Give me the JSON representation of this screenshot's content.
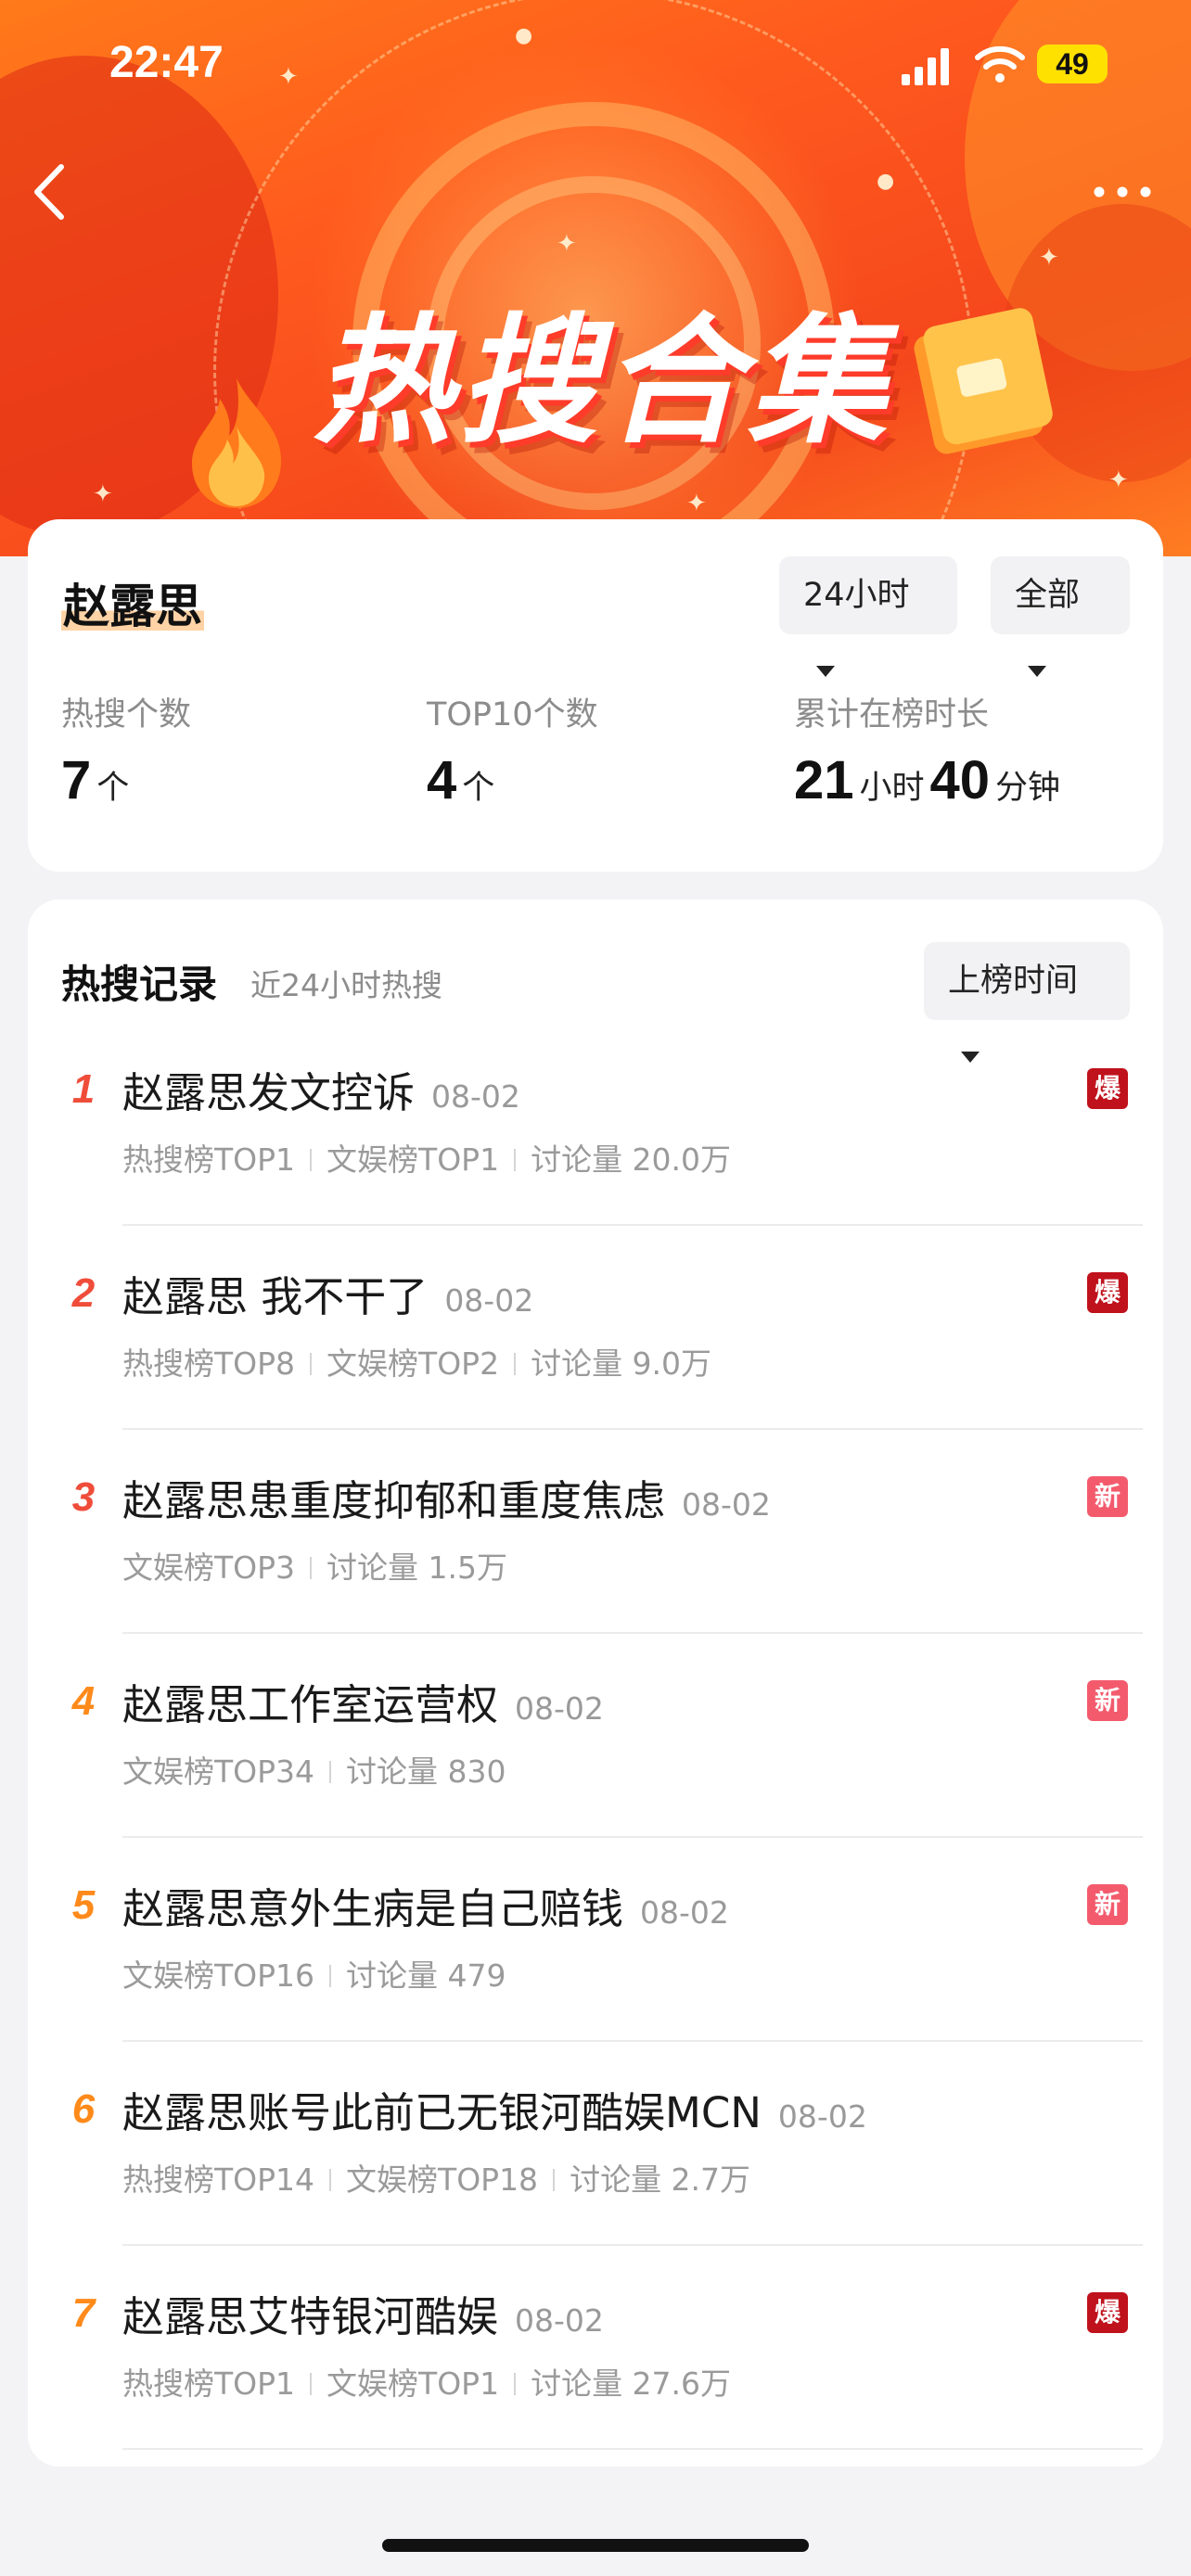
{
  "status_bar": {
    "time": "22:47",
    "battery": "49"
  },
  "banner": {
    "title": "热搜合集"
  },
  "summary": {
    "name": "赵露思",
    "filter_time": "24小时",
    "filter_scope": "全部",
    "stats": [
      {
        "label": "热搜个数",
        "value": "7",
        "unit": "个"
      },
      {
        "label": "TOP10个数",
        "value": "4",
        "unit": "个"
      },
      {
        "label": "累计在榜时长",
        "hours": "21",
        "hours_unit": "小时",
        "minutes": "40",
        "minutes_unit": "分钟"
      }
    ]
  },
  "records": {
    "title": "热搜记录",
    "subtitle": "近24小时热搜",
    "sort_label": "上榜时间",
    "items": [
      {
        "rank": "1",
        "title": "赵露思发文控诉",
        "date": "08-02",
        "meta": [
          "热搜榜TOP1",
          "文娱榜TOP1",
          "讨论量 20.0万"
        ],
        "badge": "爆"
      },
      {
        "rank": "2",
        "title": "赵露思 我不干了",
        "date": "08-02",
        "meta": [
          "热搜榜TOP8",
          "文娱榜TOP2",
          "讨论量 9.0万"
        ],
        "badge": "爆"
      },
      {
        "rank": "3",
        "title": "赵露思患重度抑郁和重度焦虑",
        "date": "08-02",
        "meta": [
          "文娱榜TOP3",
          "讨论量 1.5万"
        ],
        "badge": "新"
      },
      {
        "rank": "4",
        "title": "赵露思工作室运营权",
        "date": "08-02",
        "meta": [
          "文娱榜TOP34",
          "讨论量 830"
        ],
        "badge": "新"
      },
      {
        "rank": "5",
        "title": "赵露思意外生病是自己赔钱",
        "date": "08-02",
        "meta": [
          "文娱榜TOP16",
          "讨论量 479"
        ],
        "badge": "新"
      },
      {
        "rank": "6",
        "title": "赵露思账号此前已无银河酷娱MCN",
        "date": "08-02",
        "meta": [
          "热搜榜TOP14",
          "文娱榜TOP18",
          "讨论量 2.7万"
        ],
        "badge": ""
      },
      {
        "rank": "7",
        "title": "赵露思艾特银河酷娱",
        "date": "08-02",
        "meta": [
          "热搜榜TOP1",
          "文娱榜TOP1",
          "讨论量 27.6万"
        ],
        "badge": "爆"
      }
    ]
  }
}
